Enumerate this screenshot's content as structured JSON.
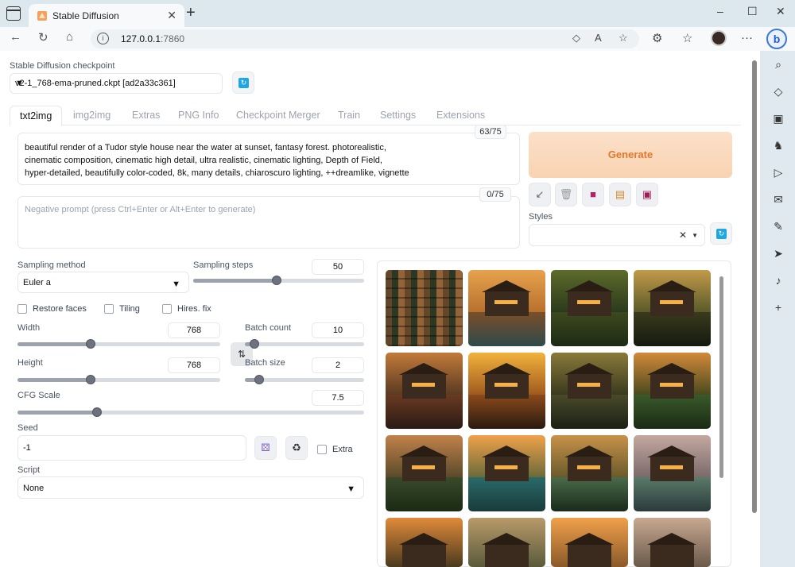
{
  "browser": {
    "tab_title": "Stable Diffusion",
    "tab_close": "✕",
    "new_tab": "+",
    "url_host": "127.0.0.1",
    "url_port": ":7860",
    "window_controls": [
      "–",
      "☐",
      "✕"
    ]
  },
  "checkpoint": {
    "label": "Stable Diffusion checkpoint",
    "value": "v2-1_768-ema-pruned.ckpt [ad2a33c361]"
  },
  "tabs": [
    "txt2img",
    "img2img",
    "Extras",
    "PNG Info",
    "Checkpoint Merger",
    "Train",
    "Settings",
    "Extensions"
  ],
  "prompt": {
    "text": "beautiful render of a Tudor style house near the water at sunset, fantasy forest. photorealistic,\ncinematic composition, cinematic high detail, ultra realistic, cinematic lighting, Depth of Field,\nhyper-detailed, beautifully color-coded, 8k, many details, chiaroscuro lighting, ++dreamlike, vignette",
    "token_count": "63/75"
  },
  "negative_prompt": {
    "placeholder": "Negative prompt (press Ctrl+Enter or Alt+Enter to generate)",
    "token_count": "0/75"
  },
  "generate_label": "Generate",
  "styles_label": "Styles",
  "sampling": {
    "method_label": "Sampling method",
    "method_value": "Euler a",
    "steps_label": "Sampling steps",
    "steps_value": "50",
    "steps_fraction": 0.49
  },
  "checkboxes": {
    "restore_faces": "Restore faces",
    "tiling": "Tiling",
    "hires_fix": "Hires. fix",
    "extra": "Extra"
  },
  "width": {
    "label": "Width",
    "value": "768",
    "fraction": 0.36
  },
  "height": {
    "label": "Height",
    "value": "768",
    "fraction": 0.36
  },
  "batch_count": {
    "label": "Batch count",
    "value": "10",
    "fraction": 0.08
  },
  "batch_size": {
    "label": "Batch size",
    "value": "2",
    "fraction": 0.12
  },
  "cfg": {
    "label": "CFG Scale",
    "value": "7.5",
    "fraction": 0.23
  },
  "seed": {
    "label": "Seed",
    "value": "-1"
  },
  "script": {
    "label": "Script",
    "value": "None"
  },
  "colors": {
    "generate_bg": "#f9d3b2",
    "generate_text": "#e0792f",
    "refresh_icon": "#1ea7e0"
  }
}
